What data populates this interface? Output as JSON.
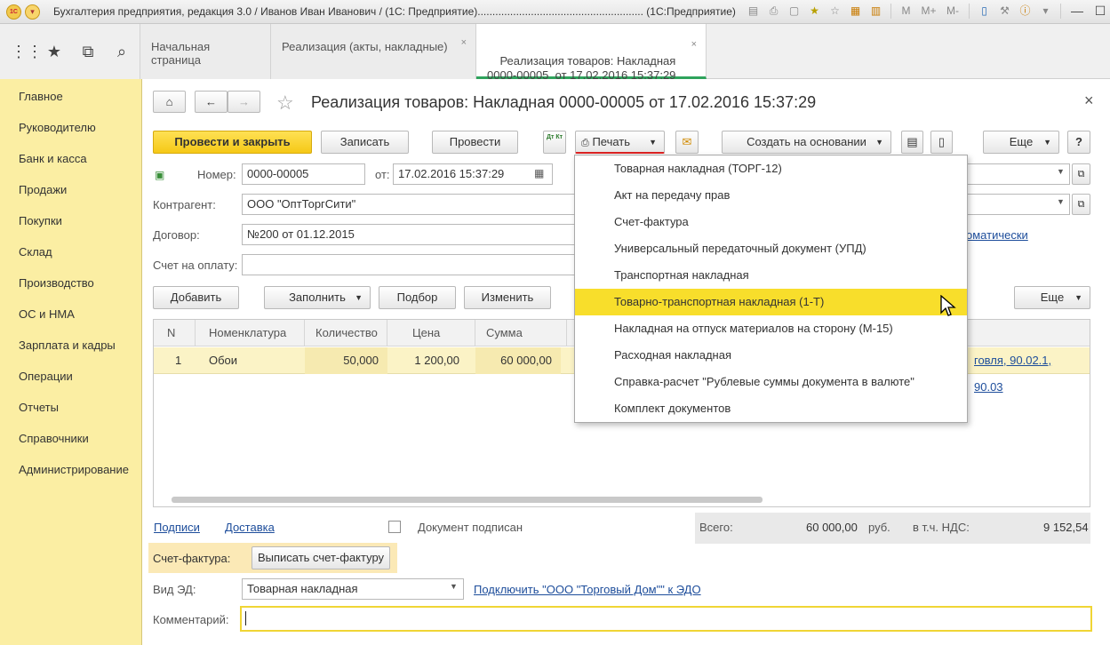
{
  "titlebar": {
    "title": "Бухгалтерия предприятия, редакция 3.0 / Иванов Иван Иванович / (1С: Предприятие)........................................................  (1С:Предприятие)",
    "logo_text": "1С",
    "icons": [
      "save-icon",
      "print-icon",
      "preview-icon",
      "favorites-icon",
      "star-icon",
      "calendar-icon",
      "calculator-icon",
      "M",
      "M+",
      "M-",
      "panel-icon",
      "wrench-icon",
      "info-icon",
      "dropdown-icon"
    ],
    "m_label": "M",
    "mplus_label": "M+",
    "mminus_label": "M-",
    "minimize": "—",
    "maximize": "☐",
    "close": "✕"
  },
  "tabs": [
    {
      "label": "Начальная страница"
    },
    {
      "label": "Реализация (акты, накладные)",
      "close": "×"
    },
    {
      "label": "Реализация товаров: Накладная\n0000-00005  от 17.02.2016 15:37:29",
      "close": "×"
    }
  ],
  "left_icons": [
    "apps-icon",
    "star-icon",
    "history-icon",
    "search-icon"
  ],
  "sidebar": {
    "items": [
      "Главное",
      "Руководителю",
      "Банк и касса",
      "Продажи",
      "Покупки",
      "Склад",
      "Производство",
      "ОС и НМА",
      "Зарплата и кадры",
      "Операции",
      "Отчеты",
      "Справочники",
      "Администрирование"
    ]
  },
  "form": {
    "title": "Реализация товаров: Накладная 0000-00005  от 17.02.2016 15:37:29",
    "close": "×",
    "toolbar": {
      "post_close": "Провести и закрыть",
      "save": "Записать",
      "post": "Провести",
      "dtkt": "Дт Кт",
      "print": "Печать",
      "create_based": "Создать на основании",
      "more": "Еще",
      "help": "?"
    },
    "number_label": "Номер:",
    "number_value": "0000-00005",
    "from_label": "от:",
    "date_value": "17.02.2016 15:37:29",
    "counterparty_label": "Контрагент:",
    "counterparty_value": "ООО \"ОптТоргСити\"",
    "contract_label": "Договор:",
    "contract_value": "№200 от 01.12.2015",
    "invoice_label": "Счет на оплату:",
    "invoice_value": "",
    "auto_link": "оматически",
    "table_toolbar": {
      "add": "Добавить",
      "fill": "Заполнить",
      "select": "Подбор",
      "change": "Изменить",
      "more": "Еще"
    },
    "table": {
      "headers": [
        "N",
        "Номенклатура",
        "Количество",
        "Цена",
        "Сумма"
      ],
      "rows": [
        {
          "n": "1",
          "item": "Обои",
          "qty": "50,000",
          "price": "1 200,00",
          "sum": "60 000,00",
          "accounts": "говля, 90.02.1, 90.03"
        }
      ]
    },
    "links": {
      "signatures": "Подписи",
      "delivery": "Доставка"
    },
    "signed_label": "Документ подписан",
    "totals": {
      "total_label": "Всего:",
      "total_value": "60 000,00",
      "currency": "руб.",
      "vat_label": "в т.ч. НДС:",
      "vat_value": "9 152,54"
    },
    "invoice_row": {
      "label": "Счет-фактура:",
      "button": "Выписать счет-фактуру"
    },
    "ed_type": {
      "label": "Вид ЭД:",
      "value": "Товарная накладная",
      "link": "Подключить \"ООО \"Торговый Дом\"\" к ЭДО"
    },
    "comment": {
      "label": "Комментарий:",
      "value": ""
    }
  },
  "print_menu": {
    "items": [
      "Товарная накладная (ТОРГ-12)",
      "Акт на передачу прав",
      "Счет-фактура",
      "Универсальный передаточный документ (УПД)",
      "Транспортная накладная",
      "Товарно-транспортная накладная (1-Т)",
      "Накладная на отпуск материалов на сторону (М-15)",
      "Расходная накладная",
      "Справка-расчет \"Рублевые суммы документа в валюте\"",
      "Комплект документов"
    ],
    "highlighted_index": 5
  }
}
